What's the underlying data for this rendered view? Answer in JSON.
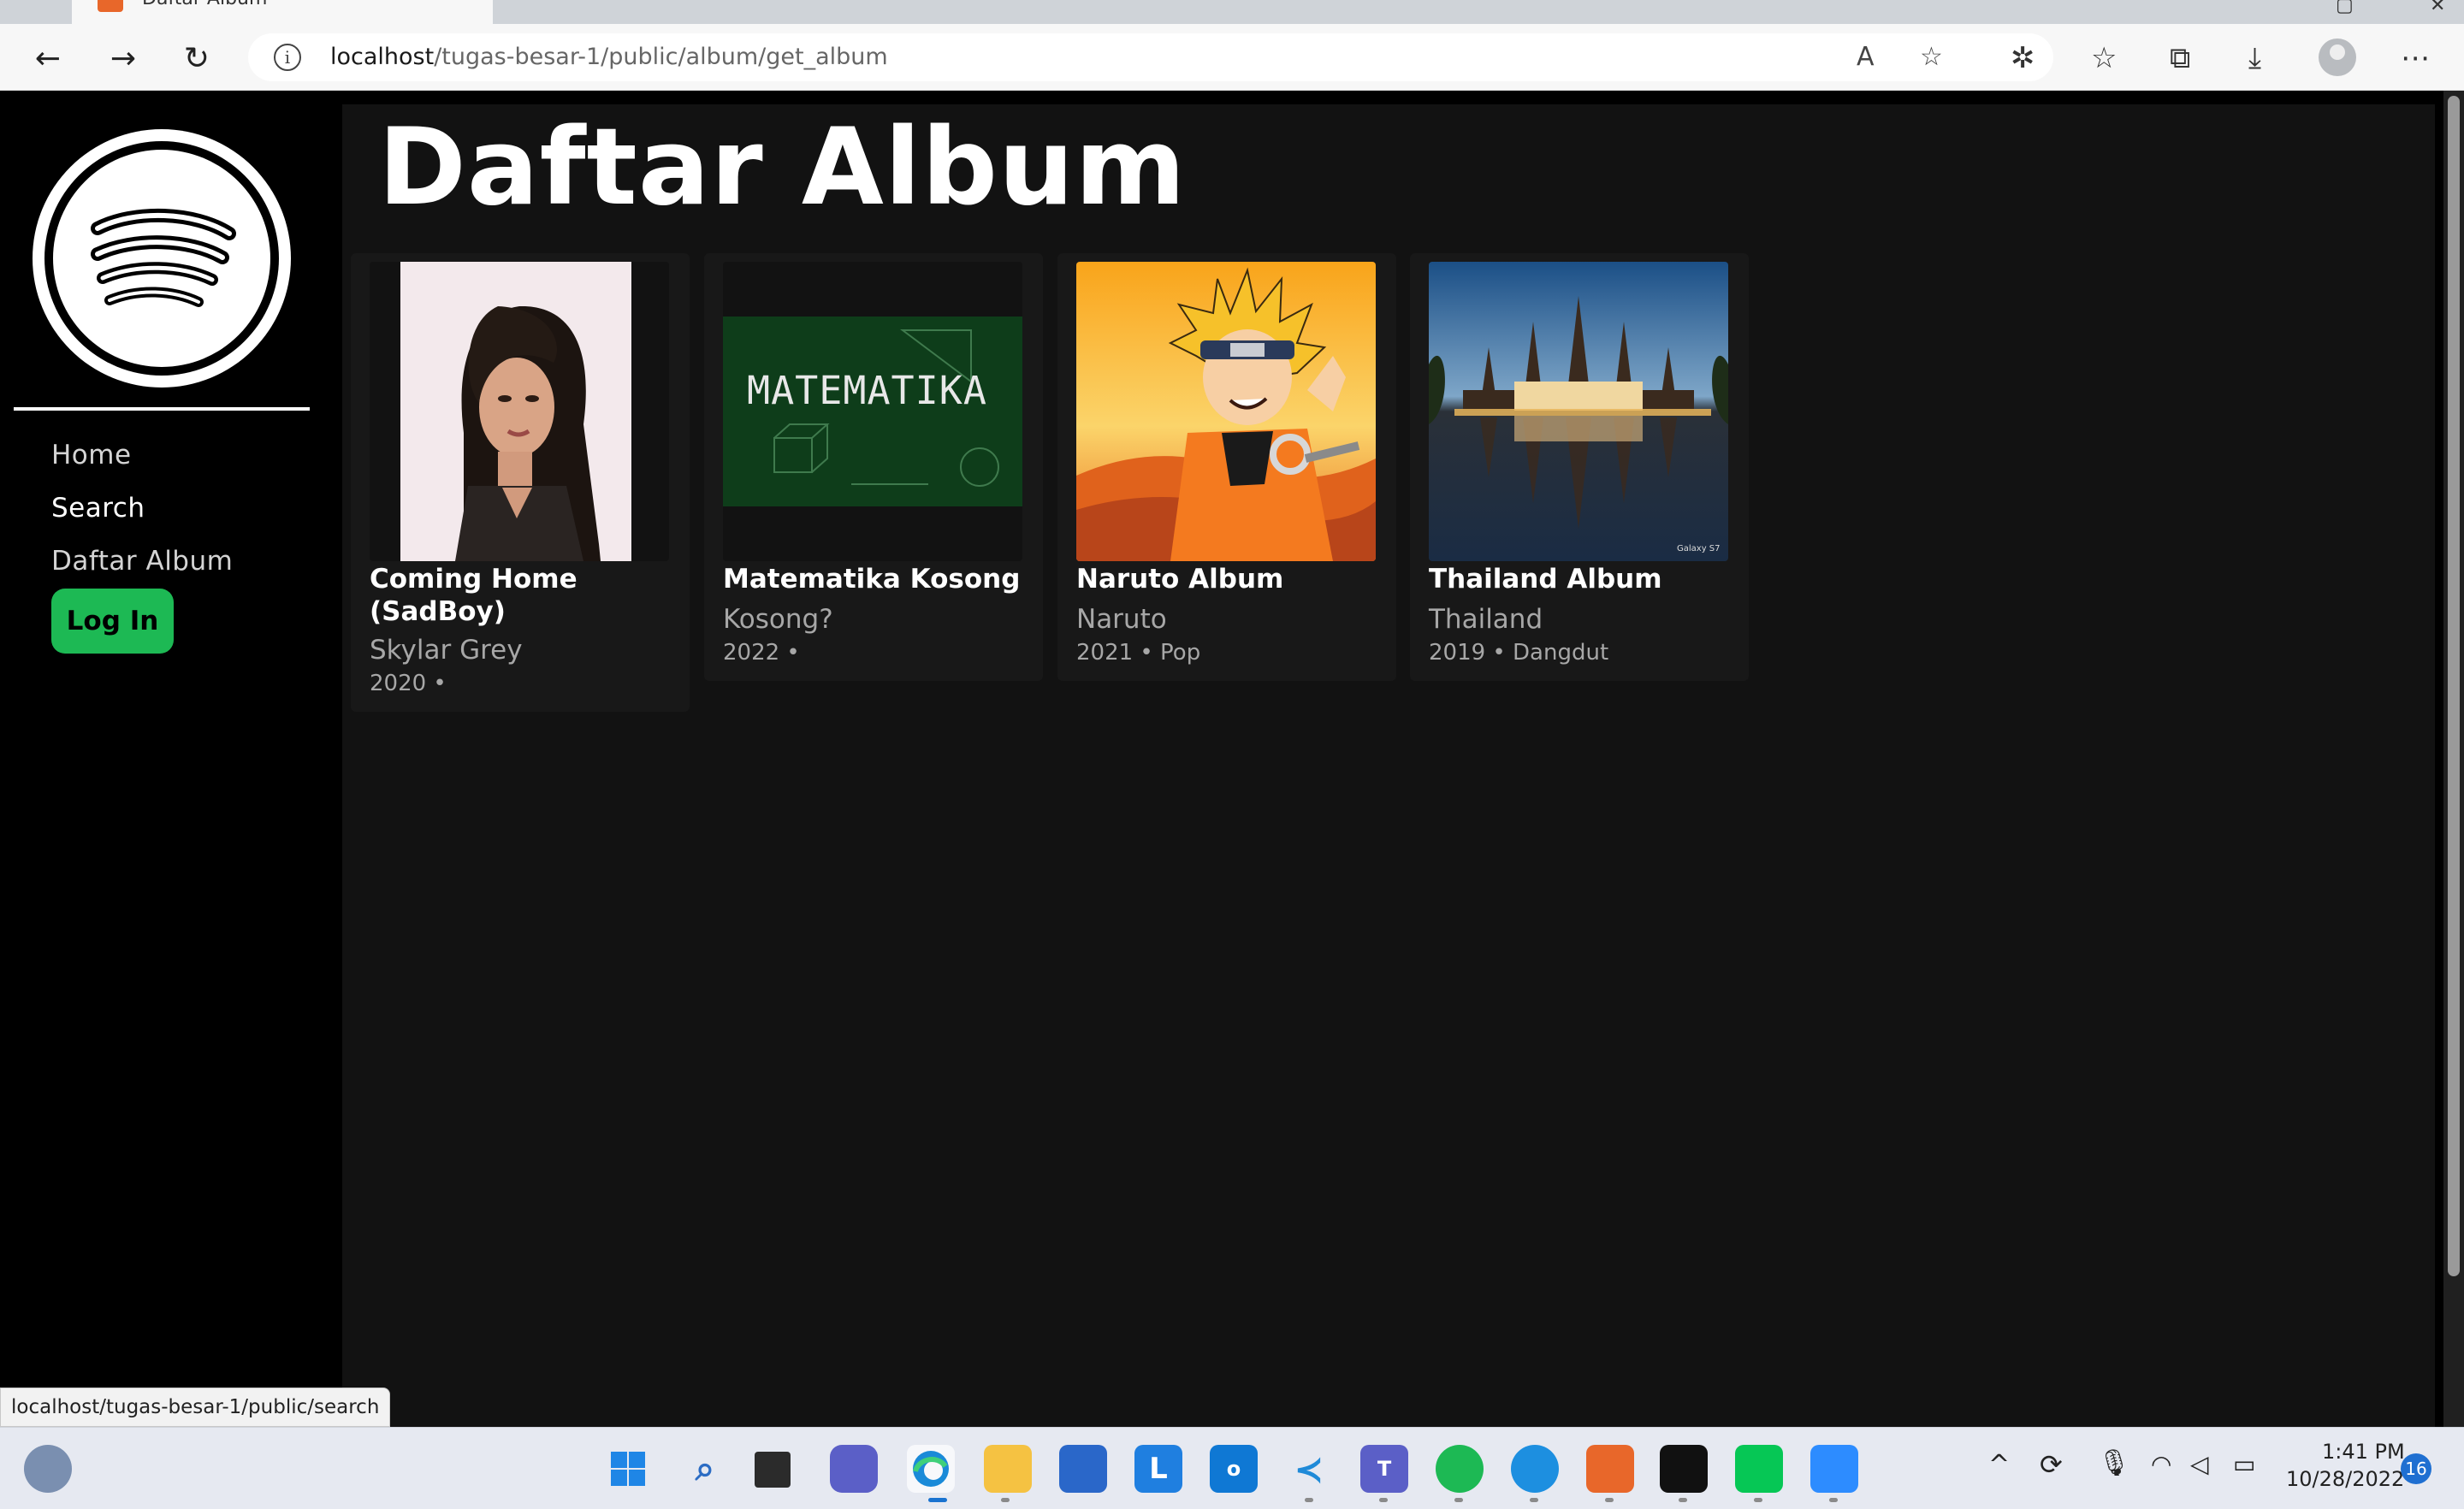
{
  "browser": {
    "tab_title": "Daftar Album",
    "url_host": "localhost",
    "url_path": "/tugas-besar-1/public/album/get_album",
    "status_url": "localhost/tugas-besar-1/public/search"
  },
  "sidebar": {
    "items": [
      {
        "label": "Home"
      },
      {
        "label": "Search"
      },
      {
        "label": "Daftar Album"
      }
    ],
    "login_label": "Log In"
  },
  "main": {
    "title": "Daftar Album",
    "albums": [
      {
        "title": "Coming Home (SadBoy)",
        "artist": "Skylar Grey",
        "meta": "2020 •"
      },
      {
        "title": "Matematika Kosong",
        "artist": "Kosong?",
        "meta": "2022 •",
        "cover_text": "MATEMATIKA"
      },
      {
        "title": "Naruto Album",
        "artist": "Naruto",
        "meta": "2021 • Pop"
      },
      {
        "title": "Thailand Album",
        "artist": "Thailand",
        "meta": "2019 • Dangdut",
        "cover_watermark": "Galaxy S7"
      }
    ]
  },
  "taskbar": {
    "time": "1:41 PM",
    "date": "10/28/2022",
    "notifications": "16"
  },
  "colors": {
    "accent": "#1db954",
    "background": "#000000",
    "main_bg": "#121212",
    "card_bg": "#181818",
    "muted_text": "#a7a7a7"
  }
}
